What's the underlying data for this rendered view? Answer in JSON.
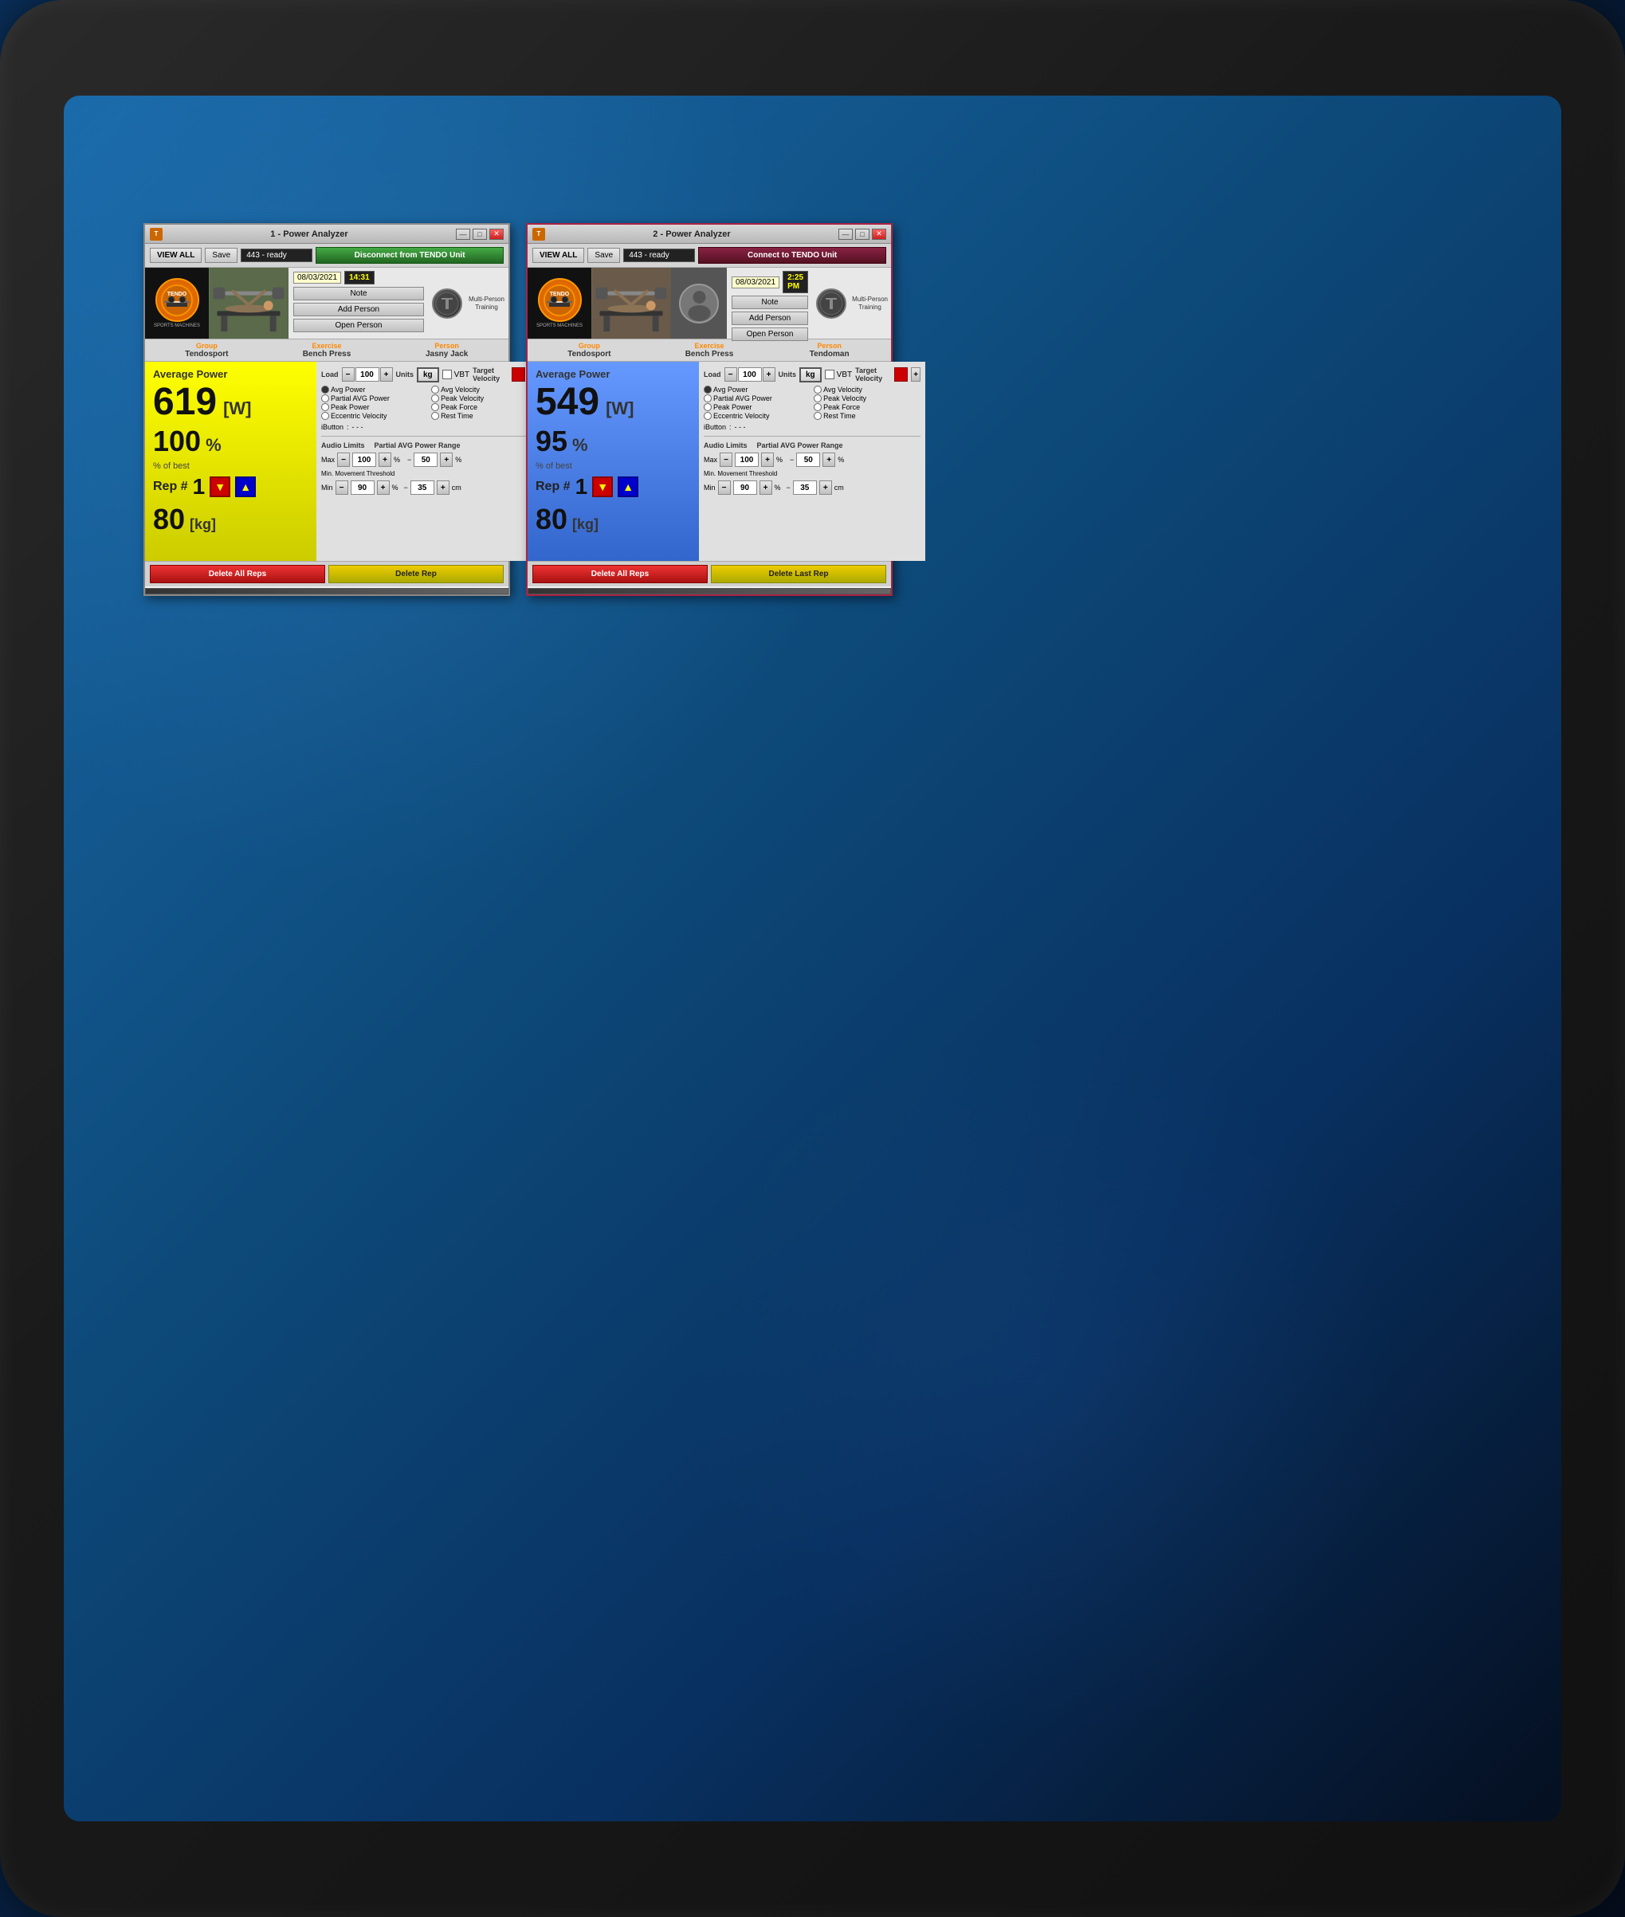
{
  "background": {
    "color": "#0d4a7a"
  },
  "window1": {
    "title": "1 - Power Analyzer",
    "icon_label": "T",
    "controls": {
      "minimize": "—",
      "maximize": "□",
      "close": "✕"
    },
    "toolbar": {
      "view_all": "VIEW ALL",
      "save": "Save",
      "unit_dropdown": "443 - ready",
      "connect_btn": "Disconnect from TENDO Unit"
    },
    "date": "08/03/2021",
    "time": "14:31",
    "note_btn": "Note",
    "add_person_btn": "Add Person",
    "open_person_btn": "Open Person",
    "multi_person": "Multi-Person Training",
    "group_label": "Group",
    "group_value": "Tendosport",
    "exercise_label": "Exercise",
    "exercise_value": "Bench Press",
    "person_label": "Person",
    "person_value": "Jasny Jack",
    "avg_power_label": "Average Power",
    "power_value": "619",
    "power_unit": "[W]",
    "percent_value": "100",
    "percent_sign": "%",
    "of_best": "% of best",
    "rep_label": "Rep #",
    "rep_number": "1",
    "load_value": "80",
    "load_unit": "[kg]",
    "load_label": "Load",
    "units_label": "Units",
    "target_velocity_label": "Target Velocity",
    "load_num": "100",
    "kg_label": "kg",
    "vbt_label": "VBT",
    "avg_power_radio": "Avg Power",
    "avg_velocity_radio": "Avg Velocity",
    "partial_avg_power_radio": "Partial AVG Power",
    "peak_velocity_radio": "Peak Velocity",
    "peak_power_radio": "Peak Power",
    "peak_force_radio": "Peak Force",
    "eccentric_velocity_radio": "Eccentric Velocity",
    "rest_time_radio": "Rest Time",
    "ibutton_label": "iButton",
    "ibutton_value": "- - -",
    "audio_limits_label": "Audio Limits",
    "partial_avg_label": "Partial AVG Power Range",
    "max_label": "Max",
    "max_value": "100",
    "min_threshold_label": "Min. Movement Threshold",
    "min_value": "90",
    "threshold_value": "35",
    "partial_pct": "%",
    "cm_label": "cm",
    "partial_range_value": "50",
    "delete_all_btn": "Delete All Reps",
    "delete_rep_btn": "Delete Rep"
  },
  "window2": {
    "title": "2 - Power Analyzer",
    "icon_label": "T",
    "controls": {
      "minimize": "—",
      "maximize": "□",
      "close": "✕"
    },
    "toolbar": {
      "view_all": "VIEW ALL",
      "save": "Save",
      "unit_dropdown": "443 - ready",
      "connect_btn": "Connect to TENDO Unit"
    },
    "date": "08/03/2021",
    "time": "2:25 PM",
    "note_btn": "Note",
    "add_person_btn": "Add Person",
    "open_person_btn": "Open Person",
    "multi_person": "Multi-Person Training",
    "group_label": "Group",
    "group_value": "Tendosport",
    "exercise_label": "Exercise",
    "exercise_value": "Bench Press",
    "person_label": "Person",
    "person_value": "Tendoman",
    "avg_power_label": "Average Power",
    "power_value": "549",
    "power_unit": "[W]",
    "percent_value": "95",
    "percent_sign": "%",
    "of_best": "% of best",
    "rep_label": "Rep #",
    "rep_number": "1",
    "load_value": "80",
    "load_unit": "[kg]",
    "load_label": "Load",
    "units_label": "Units",
    "target_velocity_label": "Target Velocity",
    "load_num": "100",
    "kg_label": "kg",
    "vbt_label": "VBT",
    "avg_power_radio": "Avg Power",
    "avg_velocity_radio": "Avg Velocity",
    "partial_avg_power_radio": "Partial AVG Power",
    "peak_velocity_radio": "Peak Velocity",
    "peak_power_radio": "Peak Power",
    "peak_force_radio": "Peak Force",
    "eccentric_velocity_radio": "Eccentric Velocity",
    "rest_time_radio": "Rest Time",
    "ibutton_label": "iButton",
    "ibutton_value": "- - -",
    "audio_limits_label": "Audio Limits",
    "partial_avg_label": "Partial AVG Power Range",
    "max_label": "Max",
    "max_value": "100",
    "min_threshold_label": "Min. Movement Threshold",
    "min_value": "90",
    "threshold_value": "35",
    "partial_pct": "%",
    "cm_label": "cm",
    "partial_range_value": "50",
    "delete_all_btn": "Delete All Reps",
    "delete_rep_btn": "Delete Last Rep"
  }
}
